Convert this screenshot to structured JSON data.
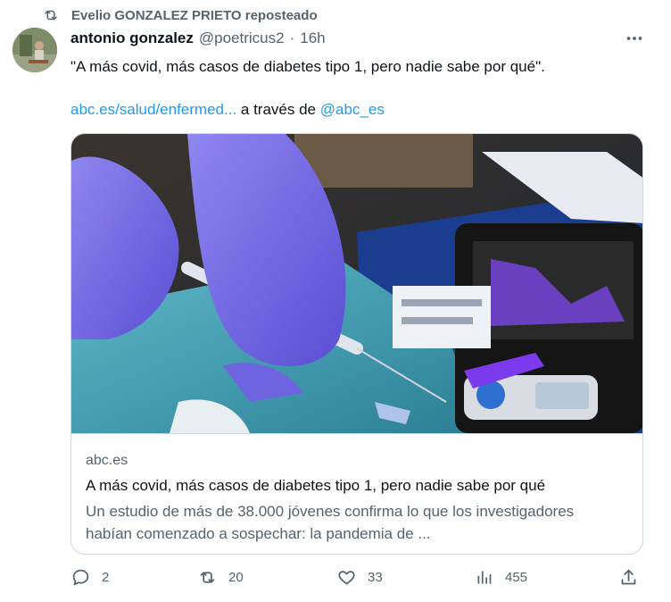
{
  "repost": {
    "icon": "repost-icon",
    "text": "Evelio GONZALEZ PRIETO reposteado"
  },
  "author": {
    "name": "antonio gonzalez",
    "handle": "@poetricus2",
    "separator": "·",
    "time": "16h"
  },
  "tweet": {
    "text": "\"A más covid, más casos de diabetes tipo 1, pero nadie sabe por qué\".",
    "link_text": "abc.es/salud/enfermed...",
    "via_text": "a través de",
    "mention": "@abc_es"
  },
  "card": {
    "domain": "abc.es",
    "title": "A más covid, más casos de diabetes tipo 1, pero nadie sabe por qué",
    "description": "Un estudio de más de 38.000 jóvenes confirma lo que los investigadores habían comenzado a sospechar: la pandemia de ..."
  },
  "actions": {
    "replies": "2",
    "reposts": "20",
    "likes": "33",
    "views": "455"
  },
  "colors": {
    "link": "#1d9bf0",
    "secondary_text": "#536471",
    "border": "#cfd9de"
  }
}
